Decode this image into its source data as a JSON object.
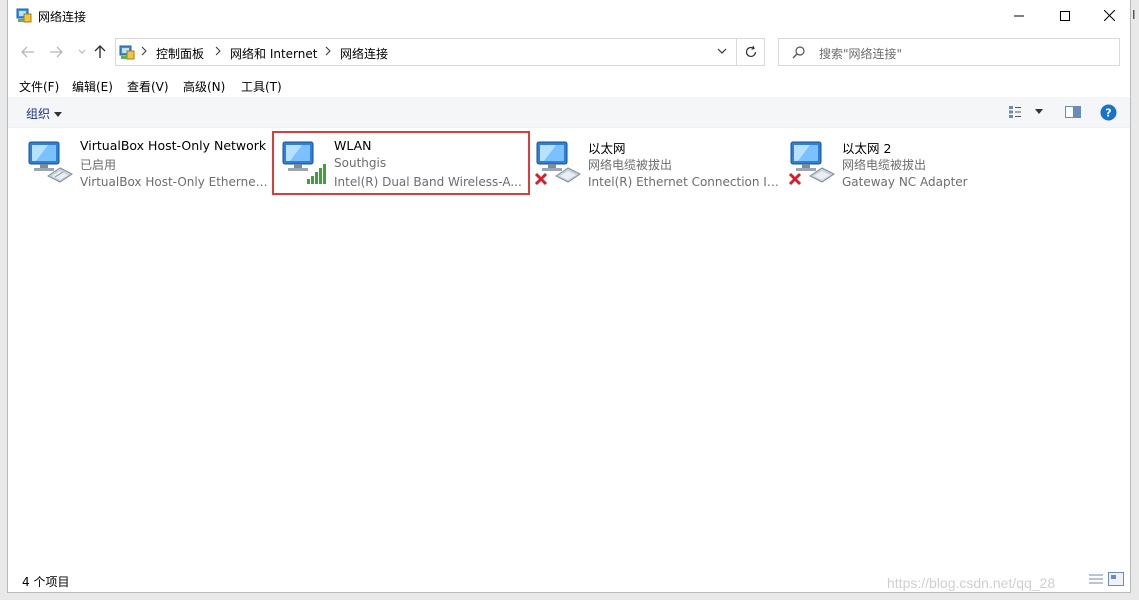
{
  "window": {
    "title": "网络连接"
  },
  "nav": {
    "breadcrumbs": [
      "控制面板",
      "网络和 Internet",
      "网络连接"
    ]
  },
  "search": {
    "placeholder": "搜索\"网络连接\""
  },
  "menu": {
    "items": [
      "文件(F)",
      "编辑(E)",
      "查看(V)",
      "高级(N)",
      "工具(T)"
    ]
  },
  "toolbar": {
    "organize_label": "组织"
  },
  "connections": [
    {
      "name": "VirtualBox Host-Only Network",
      "status": "已启用",
      "device": "VirtualBox Host-Only Ethernet ...",
      "icon": "network-adapter-icon"
    },
    {
      "name": "WLAN",
      "status": "Southgis",
      "device": "Intel(R) Dual Band Wireless-A...",
      "icon": "wifi-signal-icon"
    },
    {
      "name": "以太网",
      "status": "网络电缆被拔出",
      "device": "Intel(R) Ethernet Connection I2...",
      "icon": "disconnected-x-icon"
    },
    {
      "name": "以太网 2",
      "status": "网络电缆被拔出",
      "device": "Gateway NC Adapter",
      "icon": "disconnected-x-icon"
    }
  ],
  "statusbar": {
    "count": "4 个项目"
  },
  "watermark": "https://blog.csdn.net/qq_28",
  "edge_glyph": "I",
  "colors": {
    "selection_outline": "#e03a3a",
    "help_icon": "#1a73c8",
    "wifi_bars": "#3fa136",
    "error_x": "#d2202c"
  }
}
